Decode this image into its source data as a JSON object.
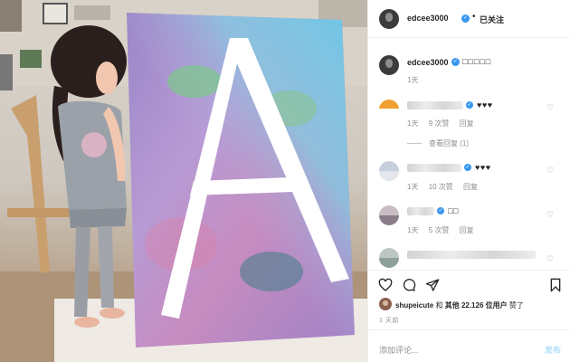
{
  "post_header": {
    "username": "edcee3000",
    "separator": "•",
    "follow_label": "已关注"
  },
  "caption": {
    "username": "edcee3000",
    "text": "□□□□□",
    "time": "1天"
  },
  "comments": [
    {
      "text": "♥♥♥",
      "meta": [
        "1天",
        "9 次赞",
        "回复"
      ],
      "replies": "查看回复 (1)"
    },
    {
      "text": "♥♥♥",
      "meta": [
        "1天",
        "10 次赞",
        "回复"
      ]
    },
    {
      "text": "□□",
      "meta": [
        "1天",
        "5 次赞",
        "回复"
      ]
    }
  ],
  "icons": {
    "verified": "✓",
    "heart_small": "♡",
    "like": "heart-icon",
    "comment": "comment-icon",
    "share": "share-icon",
    "save": "bookmark-icon"
  },
  "likes": {
    "user": "shupeicute",
    "and": "和",
    "others": "其他",
    "count": "22.126 位用户",
    "suffix": "赞了"
  },
  "post_time": "1 天前",
  "add_comment": {
    "placeholder": "添加评论...",
    "post_label": "发布"
  },
  "colors": {
    "verified": "#3897f0",
    "meta_gray": "#8e8e8e",
    "post_disabled": "#b2dffc"
  }
}
